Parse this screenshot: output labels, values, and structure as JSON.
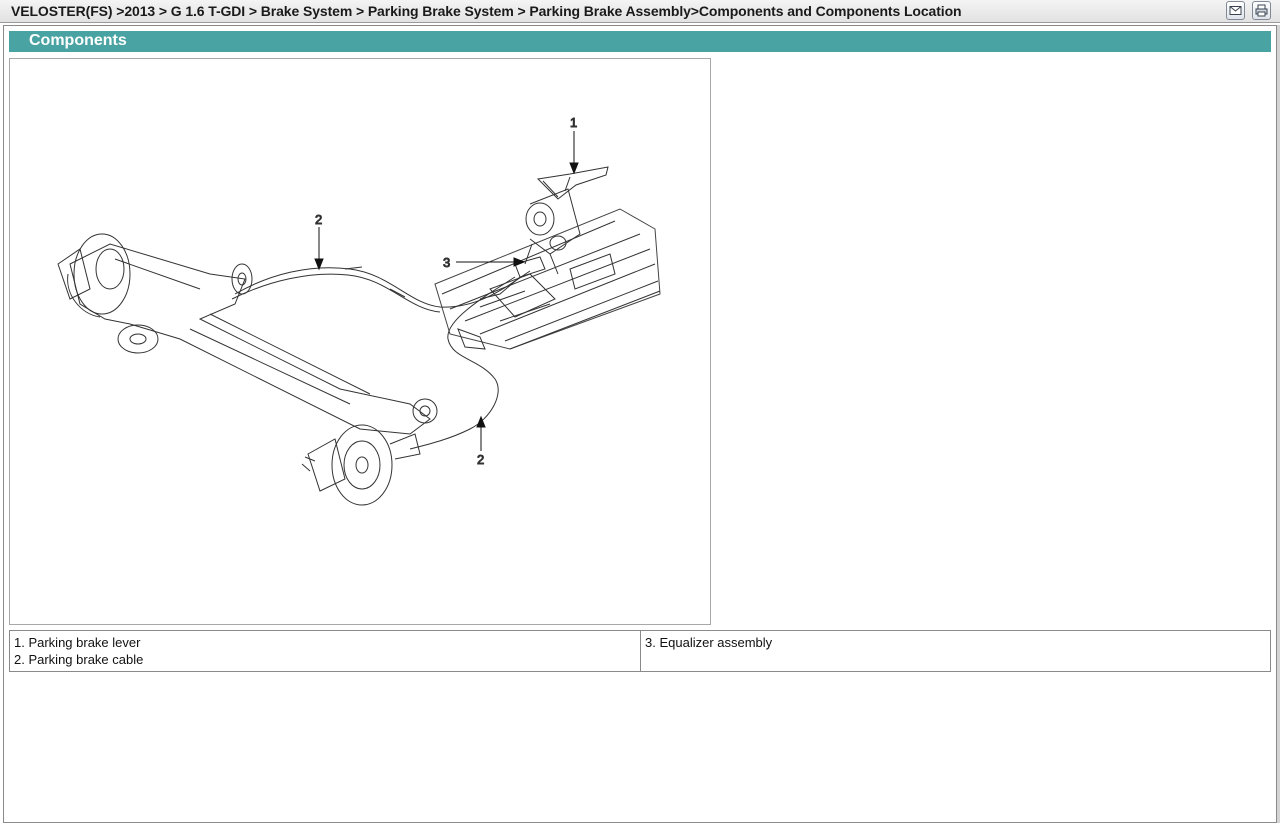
{
  "breadcrumb": "VELOSTER(FS) >2013 > G 1.6 T-GDI > Brake System > Parking Brake System > Parking Brake Assembly>Components and Components Location",
  "toolbar": {
    "email_icon": "mail-icon",
    "print_icon": "print-icon"
  },
  "section": {
    "title": "Components",
    "header_color": "#4aa3a3"
  },
  "figure": {
    "callouts": [
      "1",
      "2",
      "3",
      "2"
    ]
  },
  "legend": {
    "left": [
      "1. Parking brake lever",
      "2. Parking brake cable"
    ],
    "right": [
      "3. Equalizer assembly"
    ]
  }
}
